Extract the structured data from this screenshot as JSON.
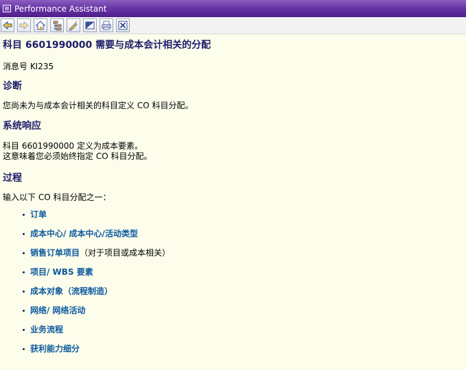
{
  "window": {
    "title": "Performance Assistant"
  },
  "toolbar": {
    "buttons": [
      {
        "icon": "back-arrow-icon"
      },
      {
        "icon": "forward-arrow-icon"
      },
      {
        "icon": "home-icon"
      },
      {
        "icon": "tree-structure-icon"
      },
      {
        "icon": "edit-pencil-icon"
      },
      {
        "icon": "display-toggle-icon"
      },
      {
        "icon": "print-icon"
      },
      {
        "icon": "close-icon"
      }
    ]
  },
  "doc": {
    "title": "科目 6601990000 需要与成本会计相关的分配",
    "message_no": "消息号 KI235",
    "diagnosis_heading": "诊断",
    "diagnosis_text": "您尚未为与成本会计相关的科目定义 CO 科目分配。",
    "system_heading": "系统响应",
    "system_line1": "科目 6601990000 定义为成本要素。",
    "system_line2": "这意味着您必须始终指定 CO 科目分配。",
    "procedure_heading": "过程",
    "procedure_intro": "输入以下 CO 科目分配之一：",
    "items": [
      {
        "link": "订单",
        "note": ""
      },
      {
        "link": "成本中心/ 成本中心/活动类型",
        "note": ""
      },
      {
        "link": "销售订单项目",
        "note": "（对于项目或成本相关）"
      },
      {
        "link": "项目/ WBS 要素",
        "note": ""
      },
      {
        "link": "成本对象（流程制造）",
        "note": ""
      },
      {
        "link": "网络/ 网络活动",
        "note": ""
      },
      {
        "link": "业务流程",
        "note": ""
      },
      {
        "link": "获利能力细分",
        "note": ""
      }
    ]
  }
}
